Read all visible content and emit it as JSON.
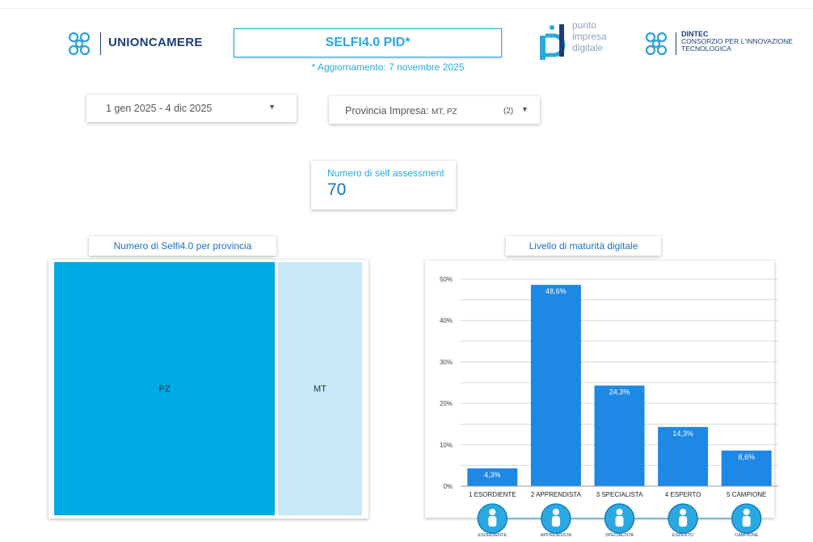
{
  "header": {
    "unioncamere_text": "UNIONCAMERE",
    "title": "SELFI4.0 PID*",
    "update_note": "* Aggiornamento: 7 novembre 2025",
    "pid_lines": [
      "punto",
      "impresa",
      "digitale"
    ],
    "dintec_title": "DINTEC",
    "dintec_lines": [
      "CONSORZIO PER L'INNOVAZIONE",
      "TECNOLOGICA"
    ]
  },
  "filters": {
    "date_range": "1 gen 2025 - 4 dic 2025",
    "province_label": "Provincia Impresa:",
    "province_value": "MT, PZ",
    "province_count": "(2)"
  },
  "kpi": {
    "label": "Numero di self assessment",
    "value": "70"
  },
  "treemap": {
    "title": "Numero di Selfi4.0 per provincia",
    "cells": [
      {
        "label": "PZ",
        "color": "#00aae2"
      },
      {
        "label": "MT",
        "color": "#cbeaf7"
      }
    ]
  },
  "chart_data": {
    "type": "bar",
    "title": "Livello di maturità digitale",
    "categories": [
      "1 ESORDIENTE",
      "2 APPRENDISTA",
      "3 SPECIALISTA",
      "4 ESPERTO",
      "5 CAMPIONE"
    ],
    "values": [
      4.3,
      48.6,
      24.3,
      14.3,
      8.6
    ],
    "data_labels": [
      "4,3%",
      "48,6%",
      "24,3%",
      "14,3%",
      "8,6%"
    ],
    "yticks": [
      "0%",
      "10%",
      "20%",
      "30%",
      "40%",
      "50%"
    ],
    "ylim": [
      0,
      50
    ],
    "bar_color": "#1e88e5",
    "grid": true,
    "icon_labels": [
      "ESORDIENTE",
      "APPRENDISTA",
      "SPECIALISTA",
      "ESPERTO",
      "CAMPIONE"
    ]
  },
  "colors": {
    "accent": "#29a9e0",
    "brand": "#1d3f78"
  }
}
